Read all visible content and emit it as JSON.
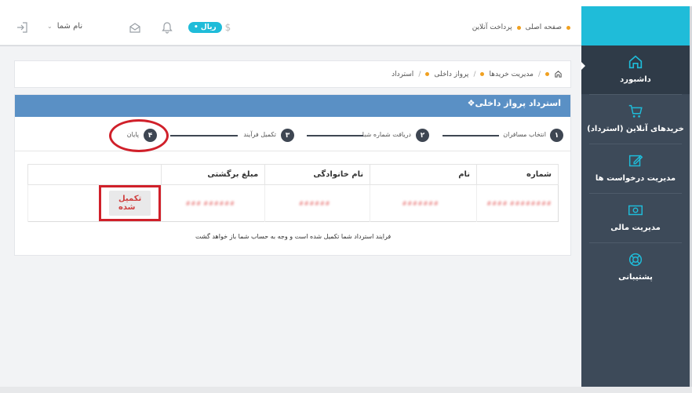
{
  "topbar": {
    "breadcrumb": [
      "صفحه اصلی",
      "پرداخت آنلاین"
    ],
    "currency_label": "• ریال",
    "currency_symbol": "$",
    "user_name": "نام شما"
  },
  "sidebar": {
    "items": [
      {
        "label": "داشبورد",
        "icon": "home-icon",
        "active": true
      },
      {
        "label": "خریدهای آنلاین (استرداد)",
        "icon": "cart-icon",
        "active": false
      },
      {
        "label": "مدیریت درخواست ها",
        "icon": "edit-icon",
        "active": false
      },
      {
        "label": "مدیریت مالی",
        "icon": "money-icon",
        "active": false
      },
      {
        "label": "پشتیبانی",
        "icon": "lifebuoy-icon",
        "active": false
      }
    ]
  },
  "breadcrumb": [
    "مدیریت خریدها",
    "پرواز داخلی",
    "استرداد"
  ],
  "panel": {
    "title": "استرداد پرواز داخلی",
    "steps": [
      {
        "num": "۱",
        "label": "انتخاب مسافران"
      },
      {
        "num": "۲",
        "label": "دریافت شماره شبا"
      },
      {
        "num": "۳",
        "label": "تکمیل فرآیند"
      },
      {
        "num": "۴",
        "label": "پایان"
      }
    ],
    "table": {
      "headers": [
        "شماره",
        "نام",
        "نام خانوادگی",
        "مبلغ برگشتی",
        ""
      ],
      "rows": [
        {
          "number": "######## ####",
          "first_name": "#######",
          "last_name": "######",
          "amount": "###### ###",
          "action": "تکمیل شده"
        }
      ]
    },
    "note": "فرایند استرداد شما تکمیل شده است و وجه به حساب شما باز خواهد گشت"
  },
  "colors": {
    "accent": "#1fbcd9",
    "sidebar": "#3d4a59",
    "panel_head": "#5a90c5",
    "highlight": "#d0202a"
  }
}
